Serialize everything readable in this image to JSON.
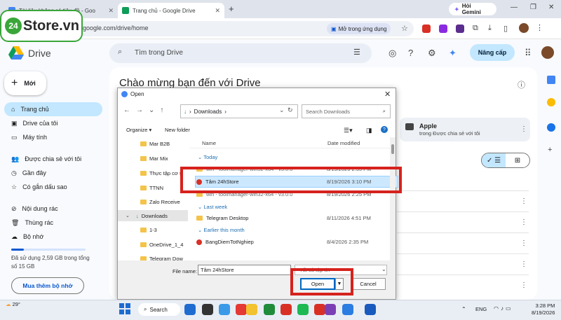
{
  "browser": {
    "tabs": [
      {
        "label": "Tài liệu không có tiêu đề - Goo",
        "color": "#4285f4"
      },
      {
        "label": "Trang chủ - Google Drive",
        "color": "#0f9d58",
        "active": true
      }
    ],
    "new_tab": "+",
    "gemini_label": "Hỏi Gemini",
    "url": "google.com/drive/home",
    "open_in_app": "Mở trong ứng dụng",
    "window_controls": {
      "minimize": "—",
      "maximize": "❐",
      "close": "✕"
    }
  },
  "watermark": {
    "badge": "24",
    "text": "Store.vn"
  },
  "drive": {
    "app_name": "Drive",
    "search_placeholder": "Tìm trong Drive",
    "upgrade_label": "Nâng cấp",
    "new_label": "Mới",
    "nav": [
      {
        "label": "Trang chủ",
        "icon": "home-icon",
        "glyph": "⌂",
        "active": true
      },
      {
        "label": "Drive của tôi",
        "icon": "drive-icon",
        "glyph": "▣"
      },
      {
        "label": "Máy tính",
        "icon": "computer-icon",
        "glyph": "▭"
      },
      {
        "label": "Được chia sẻ với tôi",
        "icon": "shared-icon",
        "glyph": "👥"
      },
      {
        "label": "Gần đây",
        "icon": "clock-icon",
        "glyph": "◷"
      },
      {
        "label": "Có gắn dấu sao",
        "icon": "star-icon",
        "glyph": "☆"
      },
      {
        "label": "Nội dung rác",
        "icon": "spam-icon",
        "glyph": "⊘"
      },
      {
        "label": "Thùng rác",
        "icon": "trash-icon",
        "glyph": "🗑"
      },
      {
        "label": "Bộ nhớ",
        "icon": "cloud-icon",
        "glyph": "☁"
      }
    ],
    "storage_text": "Đã sử dụng 2,59 GB trong tổng số 15 GB",
    "storage_fraction": 0.17,
    "buy_storage": "Mua thêm bộ nhớ",
    "welcome": "Chào mừng bạn đến với Drive",
    "suggested_folder": {
      "name": "Apple",
      "subtitle": "trong Được chia sẻ với tôi"
    }
  },
  "dialog": {
    "title": "Open",
    "path": "Downloads",
    "search_placeholder": "Search Downloads",
    "organize": "Organize",
    "new_folder": "New folder",
    "nav_items": [
      {
        "label": "Mar B2B",
        "type": "folder"
      },
      {
        "label": "Mar Mix",
        "type": "folder"
      },
      {
        "label": "Thực tập cơ s",
        "type": "folder"
      },
      {
        "label": "TTNN",
        "type": "folder"
      },
      {
        "label": "Zalo Receive",
        "type": "folder"
      },
      {
        "label": "Downloads",
        "type": "download",
        "selected": true
      },
      {
        "label": "1-3",
        "type": "folder"
      },
      {
        "label": "OneDrive_1_4",
        "type": "folder"
      },
      {
        "label": "Telegram Dow",
        "type": "folder"
      }
    ],
    "columns": {
      "name": "Name",
      "date": "Date modified"
    },
    "groups": [
      {
        "label": "Today",
        "files": [
          {
            "name": "win - toolmanager-win32-x64 - v3.0.0",
            "date": "8/19/2026 2:35 PM",
            "kind": "folder"
          },
          {
            "name": "Tâm 24hStore",
            "date": "8/19/2026 3:10 PM",
            "kind": "chrome",
            "selected": true
          },
          {
            "name": "win - toolmanager-win32-x64 - v3.0.0",
            "date": "8/19/2026 2:25 PM",
            "kind": "folder"
          }
        ]
      },
      {
        "label": "Last week",
        "files": [
          {
            "name": "Telegram Desktop",
            "date": "8/11/2026 4:51 PM",
            "kind": "folder"
          }
        ]
      },
      {
        "label": "Earlier this month",
        "files": [
          {
            "name": "BangDiemTotNghiep",
            "date": "8/4/2026 2:35 PM",
            "kind": "chrome"
          }
        ]
      }
    ],
    "file_name_label": "File name:",
    "file_name_value": "Tâm 24hStore",
    "file_type": "Tất cả tệp tin",
    "open_label": "Open",
    "cancel_label": "Cancel"
  },
  "taskbar": {
    "temperature": "29°",
    "search_label": "Search",
    "language": "ENG",
    "time": "3:28 PM",
    "date": "8/19/2026",
    "apps": [
      "#1e6cd0",
      "#333333",
      "#3a9ae8",
      "#e53935",
      "#f2c230",
      "#1f8c3c",
      "#d93025",
      "#1db954",
      "#d93025",
      "#7b3fb5",
      "#2a7de1",
      "#185abd"
    ]
  }
}
